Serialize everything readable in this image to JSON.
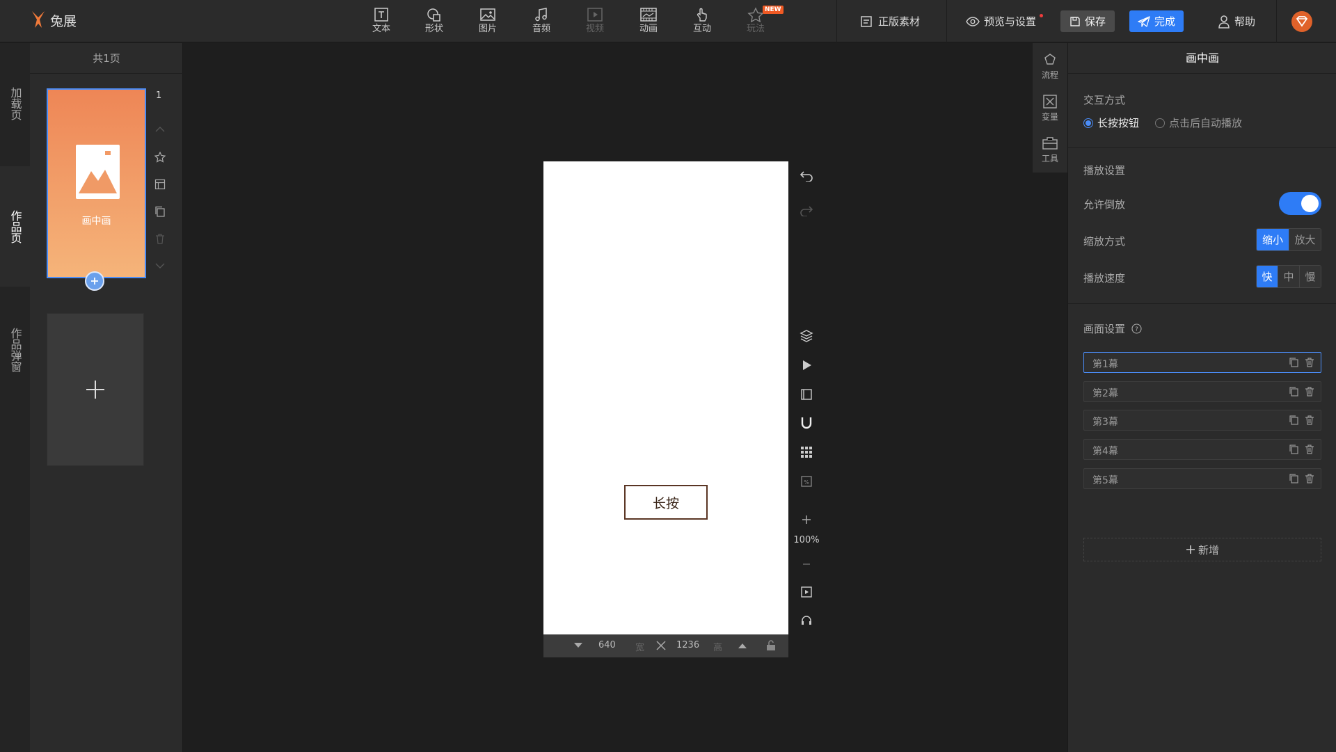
{
  "app": {
    "logo_text": "兔展"
  },
  "toolbar": {
    "tools": [
      {
        "label": "文本",
        "icon": "text-icon"
      },
      {
        "label": "形状",
        "icon": "shape-icon"
      },
      {
        "label": "图片",
        "icon": "image-icon"
      },
      {
        "label": "音频",
        "icon": "music-icon"
      },
      {
        "label": "视频",
        "icon": "video-icon"
      },
      {
        "label": "动画",
        "icon": "animation-icon"
      },
      {
        "label": "互动",
        "icon": "hand-icon"
      },
      {
        "label": "玩法",
        "icon": "star-icon",
        "badge": "NEW"
      }
    ],
    "licensed": "正版素材",
    "preview": "预览与设置",
    "save": "保存",
    "done": "完成",
    "help": "帮助"
  },
  "left_tabs": [
    {
      "label": "加载页"
    },
    {
      "label": "作品页"
    },
    {
      "label": "作品弹窗"
    }
  ],
  "pages_panel": {
    "count_label": "共1页",
    "page_number": "1",
    "thumb_label": "画中画"
  },
  "canvas": {
    "button_text": "长按",
    "width": "640",
    "width_unit": "宽",
    "height": "1236",
    "height_unit": "高",
    "zoom": "100%"
  },
  "mini_side": [
    {
      "label": "流程",
      "icon": "flow-icon"
    },
    {
      "label": "变量",
      "icon": "variable-icon"
    },
    {
      "label": "工具",
      "icon": "toolbox-icon"
    }
  ],
  "right_panel": {
    "title": "画中画",
    "interaction_label": "交互方式",
    "interaction_options": [
      "长按按钮",
      "点击后自动播放"
    ],
    "interaction_selected": "长按按钮",
    "playback_label": "播放设置",
    "reverse_label": "允许倒放",
    "reverse_enabled": true,
    "scale_label": "缩放方式",
    "scale_options": [
      "缩小",
      "放大"
    ],
    "scale_selected": "缩小",
    "speed_label": "播放速度",
    "speed_options": [
      "快",
      "中",
      "慢"
    ],
    "speed_selected": "快",
    "scene_label": "画面设置",
    "scenes": [
      "第1幕",
      "第2幕",
      "第3幕",
      "第4幕",
      "第5幕"
    ],
    "add_scene": "新增"
  },
  "colors": {
    "accent": "#2e7cf6",
    "thumb_top": "#ee8656",
    "thumb_bottom": "#f5b47a",
    "badge": "#f05a24"
  }
}
